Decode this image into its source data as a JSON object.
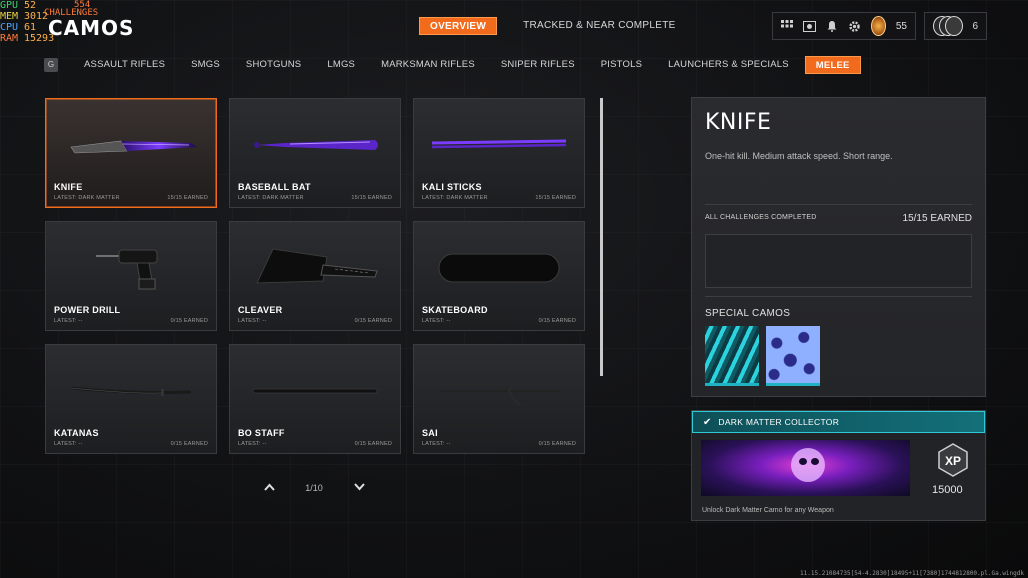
{
  "perf": {
    "gpu": {
      "label": "GPU",
      "value": "52"
    },
    "mem": {
      "label": "MEM",
      "value": "3012"
    },
    "cpu": {
      "label": "CPU",
      "value": "61"
    },
    "ram": {
      "label": "RAM",
      "value": "15293"
    },
    "extra": [
      "554",
      "CHALLENGES"
    ]
  },
  "page_title": "CAMOS",
  "top_tabs": [
    {
      "label": "OVERVIEW",
      "active": true
    },
    {
      "label": "TRACKED & NEAR COMPLETE",
      "active": false
    }
  ],
  "header": {
    "icons": [
      "grid-menu-icon",
      "media-icon",
      "bell-icon",
      "gear-icon"
    ],
    "rank_level": "55",
    "prestige_count": "6"
  },
  "category_key": "G",
  "categories": [
    {
      "label": "ASSAULT RIFLES",
      "active": false
    },
    {
      "label": "SMGS",
      "active": false
    },
    {
      "label": "SHOTGUNS",
      "active": false
    },
    {
      "label": "LMGS",
      "active": false
    },
    {
      "label": "MARKSMAN RIFLES",
      "active": false
    },
    {
      "label": "SNIPER RIFLES",
      "active": false
    },
    {
      "label": "PISTOLS",
      "active": false
    },
    {
      "label": "LAUNCHERS & SPECIALS",
      "active": false
    },
    {
      "label": "MELEE",
      "active": true
    }
  ],
  "weapons": [
    {
      "name": "KNIFE",
      "latest": "LATEST: DARK MATTER",
      "earned": "15/15 EARNED",
      "selected": true,
      "art": "knife-dark-matter"
    },
    {
      "name": "BASEBALL BAT",
      "latest": "LATEST: DARK MATTER",
      "earned": "15/15 EARNED",
      "selected": false,
      "art": "bat-dark-matter"
    },
    {
      "name": "KALI STICKS",
      "latest": "LATEST: DARK MATTER",
      "earned": "15/15 EARNED",
      "selected": false,
      "art": "sticks-dark-matter"
    },
    {
      "name": "POWER DRILL",
      "latest": "LATEST: --",
      "earned": "0/15 EARNED",
      "selected": false,
      "art": "drill"
    },
    {
      "name": "CLEAVER",
      "latest": "LATEST: --",
      "earned": "0/15 EARNED",
      "selected": false,
      "art": "cleaver"
    },
    {
      "name": "SKATEBOARD",
      "latest": "LATEST: --",
      "earned": "0/15 EARNED",
      "selected": false,
      "art": "skateboard"
    },
    {
      "name": "KATANAS",
      "latest": "LATEST: --",
      "earned": "0/15 EARNED",
      "selected": false,
      "art": "katana"
    },
    {
      "name": "BO STAFF",
      "latest": "LATEST: --",
      "earned": "0/15 EARNED",
      "selected": false,
      "art": "staff"
    },
    {
      "name": "SAI",
      "latest": "LATEST: --",
      "earned": "0/15 EARNED",
      "selected": false,
      "art": "sai"
    }
  ],
  "pager": {
    "label": "1/10"
  },
  "detail": {
    "name": "KNIFE",
    "description": "One-hit kill.  Medium attack speed. Short range.",
    "all_challenges_label": "ALL CHALLENGES COMPLETED",
    "all_challenges_value": "15/15 EARNED",
    "special_camos_label": "SPECIAL CAMOS"
  },
  "reward": {
    "title": "DARK MATTER COLLECTOR",
    "xp_value": "15000",
    "description": "Unlock Dark Matter Camo for any Weapon"
  },
  "footer": "11.15.21084735[54-4.2830]18495+11[7380]1744812800.pl.Ga.wingdk",
  "colors": {
    "accent": "#f26b1d",
    "teal": "#1fb2c2",
    "dark_matter": "#6b2bd9"
  }
}
